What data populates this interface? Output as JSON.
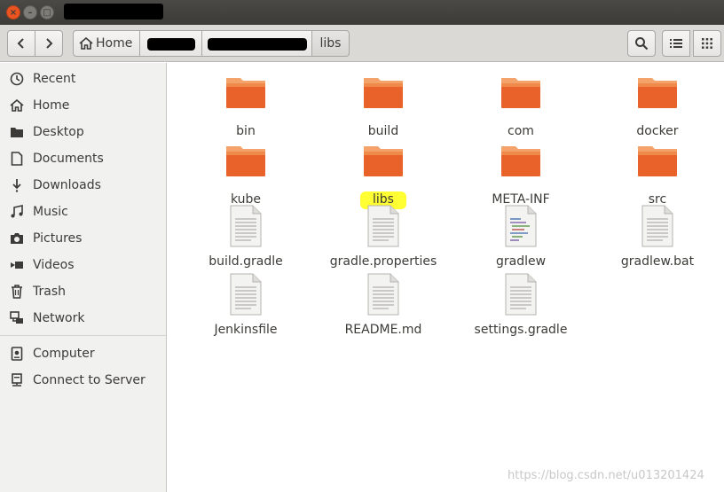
{
  "window": {
    "close_glyph": "×",
    "minimize_glyph": "–",
    "maximize_glyph": "□"
  },
  "breadcrumb": {
    "home_label": "Home",
    "current_label": "libs"
  },
  "sidebar": {
    "items": [
      {
        "label": "Recent",
        "icon": "clock-icon"
      },
      {
        "label": "Home",
        "icon": "home-icon"
      },
      {
        "label": "Desktop",
        "icon": "desktop-folder-icon"
      },
      {
        "label": "Documents",
        "icon": "document-icon"
      },
      {
        "label": "Downloads",
        "icon": "download-icon"
      },
      {
        "label": "Music",
        "icon": "music-icon"
      },
      {
        "label": "Pictures",
        "icon": "camera-icon"
      },
      {
        "label": "Videos",
        "icon": "video-icon"
      },
      {
        "label": "Trash",
        "icon": "trash-icon"
      },
      {
        "label": "Network",
        "icon": "network-icon"
      },
      {
        "label": "Computer",
        "icon": "computer-icon"
      },
      {
        "label": "Connect to Server",
        "icon": "server-icon"
      }
    ]
  },
  "files": [
    {
      "name": "bin",
      "kind": "folder"
    },
    {
      "name": "build",
      "kind": "folder"
    },
    {
      "name": "com",
      "kind": "folder"
    },
    {
      "name": "docker",
      "kind": "folder"
    },
    {
      "name": "kube",
      "kind": "folder"
    },
    {
      "name": "libs",
      "kind": "folder",
      "highlighted": true
    },
    {
      "name": "META-INF",
      "kind": "folder"
    },
    {
      "name": "src",
      "kind": "folder"
    },
    {
      "name": "build.gradle",
      "kind": "text"
    },
    {
      "name": "gradle.properties",
      "kind": "text"
    },
    {
      "name": "gradlew",
      "kind": "script"
    },
    {
      "name": "gradlew.bat",
      "kind": "text"
    },
    {
      "name": "Jenkinsfile",
      "kind": "text"
    },
    {
      "name": "README.md",
      "kind": "text"
    },
    {
      "name": "settings.gradle",
      "kind": "text"
    }
  ],
  "colors": {
    "accent": "#e95420",
    "folder_top": "#f4a36b",
    "folder_body": "#e8622a",
    "highlight": "#ffff33"
  },
  "watermark": "https://blog.csdn.net/u013201424"
}
